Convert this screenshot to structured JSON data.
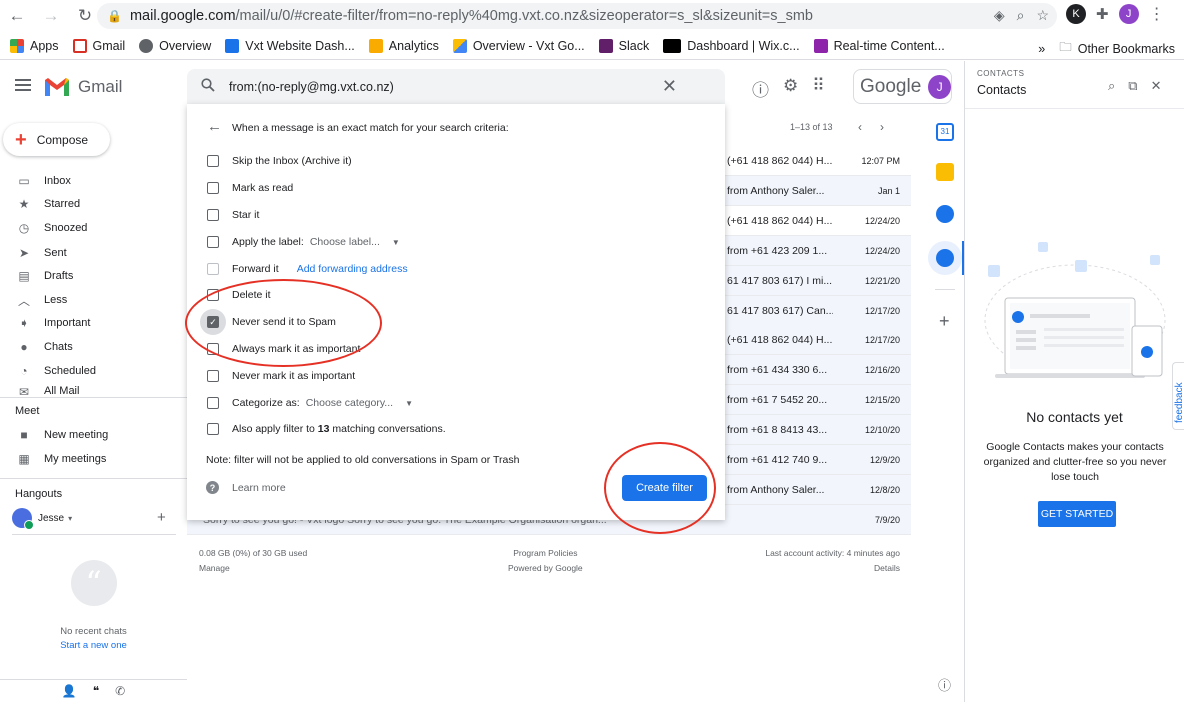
{
  "browser": {
    "url_host": "mail.google.com",
    "url_path": "/mail/u/0/#create-filter/from=no-reply%40mg.vxt.co.nz&sizeoperator=s_sl&sizeunit=s_smb",
    "profile_initial": "J",
    "ext_initial": "K"
  },
  "bookmarks": [
    {
      "label": "Apps",
      "color": "#ea4335"
    },
    {
      "label": "Gmail",
      "color": "#d93025"
    },
    {
      "label": "Overview",
      "color": "#5f6368"
    },
    {
      "label": "Vxt Website Dash...",
      "color": "#1a73e8"
    },
    {
      "label": "Analytics",
      "color": "#f9ab00"
    },
    {
      "label": "Overview - Vxt Go...",
      "color": "#4285f4"
    },
    {
      "label": "Slack",
      "color": "#611f69"
    },
    {
      "label": "Dashboard | Wix.c...",
      "color": "#000000"
    },
    {
      "label": "Real-time Content...",
      "color": "#8e24aa"
    }
  ],
  "bookmarks_more": "»",
  "bookmarks_other": "Other Bookmarks",
  "gmail": {
    "logo_text": "Gmail",
    "google_word": "Google",
    "avatar_initial": "J",
    "compose_label": "Compose"
  },
  "nav": [
    {
      "label": "Inbox",
      "icon": "▭"
    },
    {
      "label": "Starred",
      "icon": "★"
    },
    {
      "label": "Snoozed",
      "icon": "◷"
    },
    {
      "label": "Sent",
      "icon": "➤"
    },
    {
      "label": "Drafts",
      "icon": "▤"
    },
    {
      "label": "Less",
      "icon": "︿"
    },
    {
      "label": "Important",
      "icon": "➧"
    },
    {
      "label": "Chats",
      "icon": "●"
    },
    {
      "label": "Scheduled",
      "icon": "◔"
    },
    {
      "label": "All Mail",
      "icon": "✉"
    }
  ],
  "meet": {
    "heading": "Meet",
    "new_meeting": "New meeting",
    "my_meetings": "My meetings"
  },
  "hangouts": {
    "heading": "Hangouts",
    "user": "Jesse",
    "no_chats": "No recent chats",
    "start_new": "Start a new one"
  },
  "list": {
    "range": "1–13 of 13",
    "rows": [
      {
        "snippet": "(+61 418 862 044) H...",
        "date": "12:07 PM",
        "read": false
      },
      {
        "snippet": "from Anthony Saler...",
        "date": "Jan 1",
        "read": true
      },
      {
        "snippet": "(+61 418 862 044) H...",
        "date": "12/24/20",
        "read": false
      },
      {
        "snippet": "from +61 423 209 1...",
        "date": "12/24/20",
        "read": true
      },
      {
        "snippet": "61 417 803 617) I mi...",
        "date": "12/21/20",
        "read": true
      },
      {
        "snippet": "61 417 803 617) Can...",
        "date": "12/17/20",
        "read": true
      },
      {
        "snippet": "(+61 418 862 044) H...",
        "date": "12/17/20",
        "read": true
      },
      {
        "snippet": "from +61 434 330 6...",
        "date": "12/16/20",
        "read": true
      },
      {
        "snippet": "from +61 7 5452 20...",
        "date": "12/15/20",
        "read": true
      },
      {
        "snippet": "from +61 8 8413 43...",
        "date": "12/10/20",
        "read": true
      },
      {
        "snippet": "from +61 412 740 9...",
        "date": "12/9/20",
        "read": true
      },
      {
        "snippet": "from Anthony Saler...",
        "date": "12/8/20",
        "read": true
      }
    ],
    "last_row": {
      "snippet": "Sorry to see you go! - Vxt logo Sorry to see you go. The Example Organisation organ...",
      "date": "7/9/20"
    }
  },
  "footer": {
    "storage": "0.08 GB (0%) of 30 GB used",
    "manage": "Manage",
    "policies": "Program Policies",
    "powered": "Powered by Google",
    "activity": "Last account activity: 4 minutes ago",
    "details": "Details"
  },
  "search": {
    "query": "from:(no-reply@mg.vxt.co.nz)"
  },
  "filter": {
    "title": "When a message is an exact match for your search criteria:",
    "options": [
      {
        "label": "Skip the Inbox (Archive it)",
        "checked": false
      },
      {
        "label": "Mark as read",
        "checked": false
      },
      {
        "label": "Star it",
        "checked": false
      },
      {
        "label": "Apply the label:",
        "checked": false,
        "dropdown": "Choose label..."
      },
      {
        "label": "Forward it",
        "checked": false,
        "link": "Add forwarding address"
      },
      {
        "label": "Delete it",
        "checked": false
      },
      {
        "label": "Never send it to Spam",
        "checked": true
      },
      {
        "label": "Always mark it as important",
        "checked": false
      },
      {
        "label": "Never mark it as important",
        "checked": false
      },
      {
        "label": "Categorize as:",
        "checked": false,
        "dropdown": "Choose category..."
      }
    ],
    "also_apply_prefix": "Also apply filter to",
    "also_apply_count": "13",
    "also_apply_suffix": "matching conversations.",
    "note": "Note: filter will not be applied to old conversations in Spam or Trash",
    "learn_more": "Learn more",
    "create_button": "Create filter"
  },
  "contacts": {
    "small_label": "CONTACTS",
    "title": "Contacts",
    "empty_title": "No contacts yet",
    "empty_desc": "Google Contacts makes your contacts organized and clutter-free so you never lose touch",
    "get_started": "GET STARTED",
    "feedback": "feedback"
  },
  "colors": {
    "accent": "#1a73e8",
    "annotation_red": "#e53125",
    "profile_purple": "#8e44c9"
  }
}
